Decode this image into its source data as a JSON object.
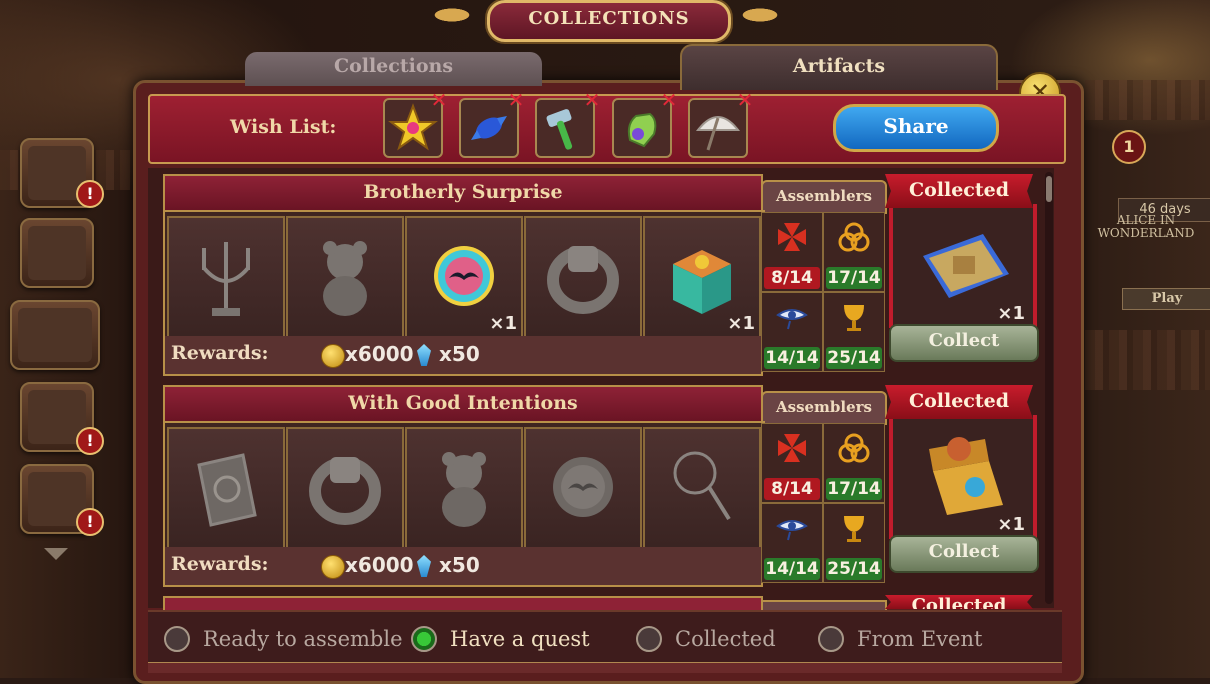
{
  "window_title": "COLLECTIONS",
  "tabs": [
    {
      "label": "Collections",
      "active": false
    },
    {
      "label": "Artifacts",
      "active": true
    }
  ],
  "wish_list": {
    "label": "Wish List:",
    "items": [
      "star-gem-icon",
      "candy-icon",
      "hammer-icon",
      "glove-icon",
      "umbrella-icon"
    ],
    "share_label": "Share"
  },
  "event": {
    "badge": "1",
    "days": "46 days",
    "title": "ALICE IN WONDERLAND",
    "play_label": "Play"
  },
  "collections": [
    {
      "title": "Brotherly Surprise",
      "assemblers_label": "Assemblers",
      "items": [
        {
          "icon": "candelabra-icon",
          "qty": ""
        },
        {
          "icon": "teddy-bear-icon",
          "qty": ""
        },
        {
          "icon": "mustache-badge-icon",
          "qty": "×1"
        },
        {
          "icon": "ring-icon",
          "qty": ""
        },
        {
          "icon": "music-box-icon",
          "qty": "×1"
        }
      ],
      "rewards_label": "Rewards:",
      "coins": "x6000",
      "gems": "x50",
      "assemblers": [
        {
          "icon": "maltese-cross-icon",
          "count": "8/14",
          "color": "red"
        },
        {
          "icon": "triquetra-icon",
          "count": "17/14",
          "color": "green"
        },
        {
          "icon": "eye-of-horus-icon",
          "count": "14/14",
          "color": "green"
        },
        {
          "icon": "chalice-icon",
          "count": "25/14",
          "color": "green"
        }
      ],
      "status": "Collected",
      "result_icon": "puzzle-picture-icon",
      "result_qty": "×1",
      "collect_label": "Collect"
    },
    {
      "title": "With Good Intentions",
      "assemblers_label": "Assemblers",
      "items": [
        {
          "icon": "book-icon",
          "qty": ""
        },
        {
          "icon": "ring-icon",
          "qty": ""
        },
        {
          "icon": "teddy-bear-icon",
          "qty": ""
        },
        {
          "icon": "mustache-badge-icon",
          "qty": ""
        },
        {
          "icon": "wand-icon",
          "qty": ""
        }
      ],
      "rewards_label": "Rewards:",
      "coins": "x6000",
      "gems": "x50",
      "assemblers": [
        {
          "icon": "maltese-cross-icon",
          "count": "8/14",
          "color": "red"
        },
        {
          "icon": "triquetra-icon",
          "count": "17/14",
          "color": "green"
        },
        {
          "icon": "eye-of-horus-icon",
          "count": "14/14",
          "color": "green"
        },
        {
          "icon": "chalice-icon",
          "count": "25/14",
          "color": "green"
        }
      ],
      "status": "Collected",
      "result_icon": "toy-chest-icon",
      "result_qty": "×1",
      "collect_label": "Collect"
    }
  ],
  "partial_row_status": "Collected",
  "legend": [
    {
      "label": "Ready to assemble",
      "selected": false
    },
    {
      "label": "Have a quest",
      "selected": true
    },
    {
      "label": "Collected",
      "selected": false
    },
    {
      "label": "From Event",
      "selected": false
    }
  ],
  "colors": {
    "accent": "#c81c2c",
    "gold": "#d8a850",
    "green": "#2a7a2a"
  }
}
